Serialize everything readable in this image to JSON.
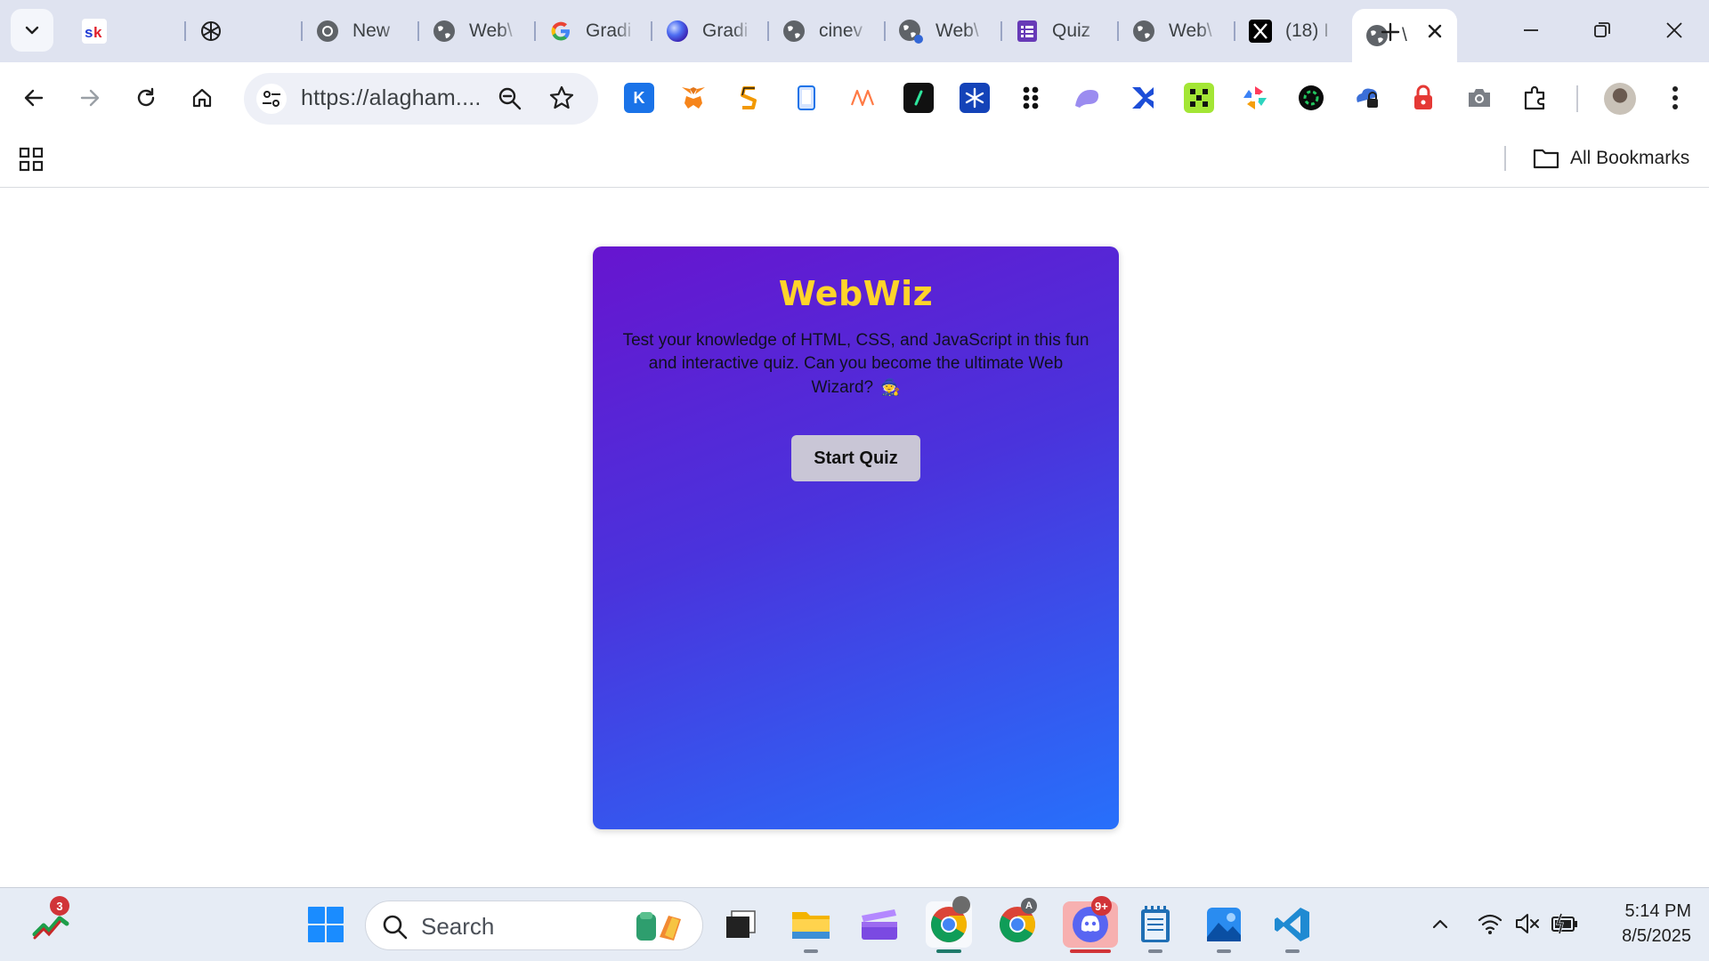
{
  "browser": {
    "tabs": [
      {
        "label": "",
        "icon": "sk-icon"
      },
      {
        "label": "",
        "icon": "openai-icon"
      },
      {
        "label": "New",
        "icon": "chrome-icon"
      },
      {
        "label": "Web\\",
        "icon": "globe-icon"
      },
      {
        "label": "Gradi",
        "icon": "google-icon"
      },
      {
        "label": "Gradi",
        "icon": "gradient-orb-icon"
      },
      {
        "label": "cinev",
        "icon": "globe-icon"
      },
      {
        "label": "Web\\",
        "icon": "globe-icon"
      },
      {
        "label": "Quiz",
        "icon": "forms-icon"
      },
      {
        "label": "Web\\",
        "icon": "globe-icon"
      },
      {
        "label": "(18) I",
        "icon": "x-icon"
      },
      {
        "label": "\\",
        "icon": "globe-icon",
        "active": true
      }
    ],
    "url": "https://alagham....",
    "bookmarks_label": "All Bookmarks",
    "extensions": [
      "k-icon",
      "metamask-icon",
      "s-icon",
      "phone-icon",
      "n-icon",
      "terminal-icon",
      "snowflake-icon",
      "dots-icon",
      "ghost-icon",
      "cross-icon",
      "pixel-icon",
      "pinwheel-icon",
      "green-orb-icon",
      "cloud-lock-icon",
      "lock-icon",
      "camera-icon",
      "puzzle-icon"
    ]
  },
  "page": {
    "title": "WebWiz",
    "description": "Test your knowledge of HTML, CSS, and JavaScript in this fun and interactive quiz. Can you become the ultimate Web Wizard?",
    "wizard_emoji": "🧙",
    "start_button": "Start Quiz",
    "colors": {
      "title": "#ffd42a",
      "gradient_start": "#6715cf",
      "gradient_end": "#2770fb",
      "button": "#c9c6d6"
    }
  },
  "taskbar": {
    "stock_badge": "3",
    "search_placeholder": "Search",
    "discord_badge": "9+",
    "chrome_profile_letter": "A",
    "time": "5:14 PM",
    "date": "8/5/2025"
  }
}
